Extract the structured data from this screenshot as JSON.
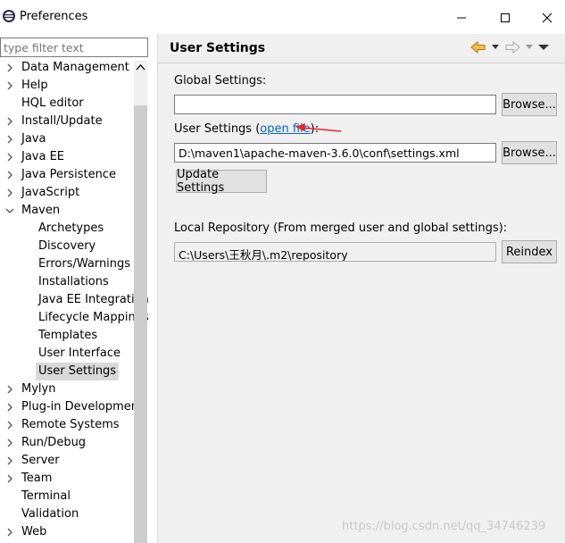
{
  "window": {
    "title": "Preferences"
  },
  "filter": {
    "placeholder": "type filter text"
  },
  "tree": {
    "items": [
      {
        "label": "Data Management",
        "chev": "right",
        "child": false
      },
      {
        "label": "Help",
        "chev": "right",
        "child": false
      },
      {
        "label": "HQL editor",
        "chev": "none",
        "child": false
      },
      {
        "label": "Install/Update",
        "chev": "right",
        "child": false
      },
      {
        "label": "Java",
        "chev": "right",
        "child": false
      },
      {
        "label": "Java EE",
        "chev": "right",
        "child": false
      },
      {
        "label": "Java Persistence",
        "chev": "right",
        "child": false
      },
      {
        "label": "JavaScript",
        "chev": "right",
        "child": false
      },
      {
        "label": "Maven",
        "chev": "down",
        "child": false
      },
      {
        "label": "Archetypes",
        "chev": "none",
        "child": true
      },
      {
        "label": "Discovery",
        "chev": "none",
        "child": true
      },
      {
        "label": "Errors/Warnings",
        "chev": "none",
        "child": true
      },
      {
        "label": "Installations",
        "chev": "none",
        "child": true
      },
      {
        "label": "Java EE Integration",
        "chev": "none",
        "child": true
      },
      {
        "label": "Lifecycle Mappings",
        "chev": "none",
        "child": true
      },
      {
        "label": "Templates",
        "chev": "none",
        "child": true
      },
      {
        "label": "User Interface",
        "chev": "none",
        "child": true
      },
      {
        "label": "User Settings",
        "chev": "none",
        "child": true,
        "selected": true
      },
      {
        "label": "Mylyn",
        "chev": "right",
        "child": false
      },
      {
        "label": "Plug-in Development",
        "chev": "right",
        "child": false
      },
      {
        "label": "Remote Systems",
        "chev": "right",
        "child": false
      },
      {
        "label": "Run/Debug",
        "chev": "right",
        "child": false
      },
      {
        "label": "Server",
        "chev": "right",
        "child": false
      },
      {
        "label": "Team",
        "chev": "right",
        "child": false
      },
      {
        "label": "Terminal",
        "chev": "none",
        "child": false
      },
      {
        "label": "Validation",
        "chev": "none",
        "child": false
      },
      {
        "label": "Web",
        "chev": "right",
        "child": false
      }
    ]
  },
  "panel": {
    "title": "User Settings",
    "global_settings_label": "Global Settings:",
    "global_settings_value": "",
    "browse_label": "Browse...",
    "user_settings_label": "User Settings (",
    "open_file_link": "open file",
    "user_settings_close": "):",
    "user_settings_value": "D:\\maven1\\apache-maven-3.6.0\\conf\\settings.xml",
    "update_settings_label": "Update Settings",
    "local_repo_label": "Local Repository (From merged user and global settings):",
    "local_repo_value": "C:\\Users\\王秋月\\.m2\\repository",
    "reindex_label": "Reindex"
  },
  "watermark": "https://blog.csdn.net/qq_34746239",
  "colors": {
    "link": "#0066cc",
    "annotation_arrow": "#e8232b"
  }
}
